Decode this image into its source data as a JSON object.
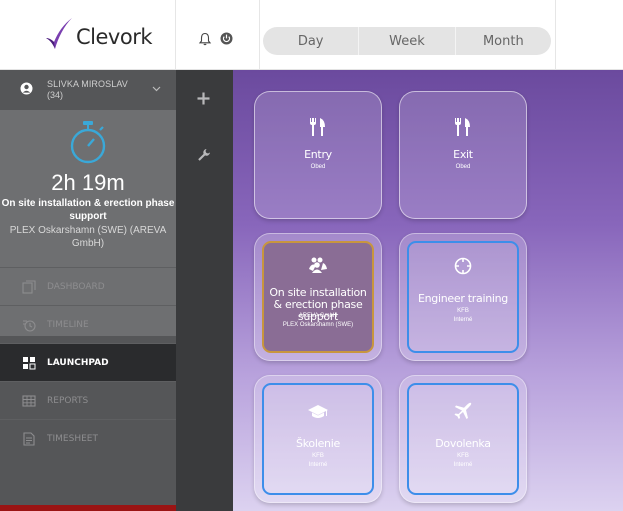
{
  "header": {
    "logo_text": "Clevork",
    "view_tabs": [
      "Day",
      "Week",
      "Month"
    ]
  },
  "user": {
    "name": "SLIVKA MIROSLAV",
    "sub": "(34)"
  },
  "timer": {
    "elapsed": "2h 19m",
    "task": "On site installation & erection phase support",
    "project": "PLEX Oskarshamn (SWE) (AREVA GmbH)"
  },
  "nav": {
    "items": [
      {
        "label": "DASHBOARD",
        "icon": "dashboard-icon"
      },
      {
        "label": "TIMELINE",
        "icon": "timeline-icon"
      },
      {
        "label": "LAUNCHPAD",
        "icon": "launchpad-icon"
      },
      {
        "label": "REPORTS",
        "icon": "reports-icon"
      },
      {
        "label": "TIMESHEET",
        "icon": "timesheet-icon"
      }
    ],
    "active": "LAUNCHPAD"
  },
  "tools": [
    "plus-icon",
    "wrench-icon"
  ],
  "tiles": [
    {
      "title": "Entry",
      "lines": [
        "Obed"
      ],
      "icon": "fork-knife-icon"
    },
    {
      "title": "Exit",
      "lines": [
        "Obed"
      ],
      "icon": "fork-knife-icon"
    },
    {
      "title": "On site installation & erection phase support",
      "lines": [
        "AREVA GmbH",
        "PLEX Oskarshamn (SWE)"
      ],
      "icon": "team-icon"
    },
    {
      "title": "Engineer training",
      "lines": [
        "KFB",
        "Interné"
      ],
      "icon": "crosshair-icon"
    },
    {
      "title": "Školenie",
      "lines": [
        "KFB",
        "Interné"
      ],
      "icon": "graduation-cap-icon"
    },
    {
      "title": "Dovolenka",
      "lines": [
        "KFB",
        "Interné"
      ],
      "icon": "airplane-icon"
    }
  ],
  "colors": {
    "accent_blue": "#3d8eea",
    "active_gold": "#c8963e",
    "timer_teal": "#3aa8d8",
    "footer_red": "#9b1414"
  }
}
